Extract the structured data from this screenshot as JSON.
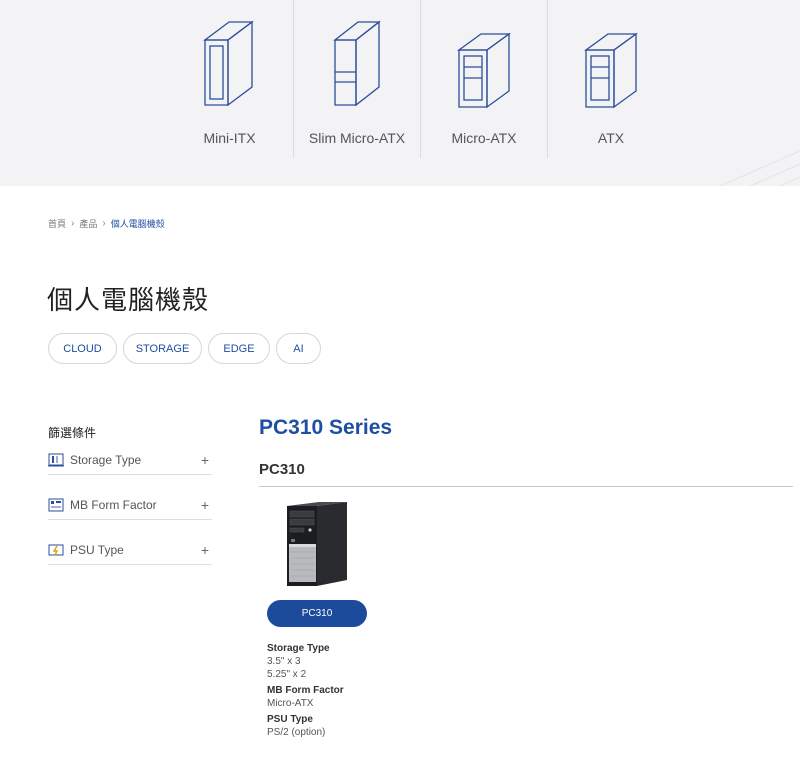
{
  "form_factors": [
    {
      "label": "Mini-ITX",
      "icon": "mini-itx-case-icon"
    },
    {
      "label": "Slim Micro-ATX",
      "icon": "slim-micro-atx-case-icon"
    },
    {
      "label": "Micro-ATX",
      "icon": "micro-atx-case-icon"
    },
    {
      "label": "ATX",
      "icon": "atx-case-icon"
    }
  ],
  "breadcrumb": {
    "home": "首頁",
    "products": "產品",
    "current": "個人電腦機殼"
  },
  "page_title": "個人電腦機殼",
  "categories": [
    "CLOUD",
    "STORAGE",
    "EDGE",
    "AI"
  ],
  "filter": {
    "title": "篩選條件",
    "items": [
      {
        "label": "Storage Type",
        "icon": "storage-type-icon"
      },
      {
        "label": "MB Form Factor",
        "icon": "mb-form-factor-icon"
      },
      {
        "label": "PSU Type",
        "icon": "psu-type-icon"
      }
    ],
    "expand_symbol": "+"
  },
  "series": {
    "title": "PC310 Series",
    "model": "PC310",
    "product_button": "PC310",
    "specs": [
      {
        "key": "Storage Type",
        "values": [
          "3.5\" x 3",
          "5.25\" x 2"
        ]
      },
      {
        "key": "MB Form Factor",
        "values": [
          "Micro-ATX"
        ]
      },
      {
        "key": "PSU Type",
        "values": [
          "PS/2 (option)"
        ]
      }
    ]
  },
  "colors": {
    "accent": "#1f4fa0",
    "button": "#1c4b9c",
    "band": "#f3f3f5"
  }
}
